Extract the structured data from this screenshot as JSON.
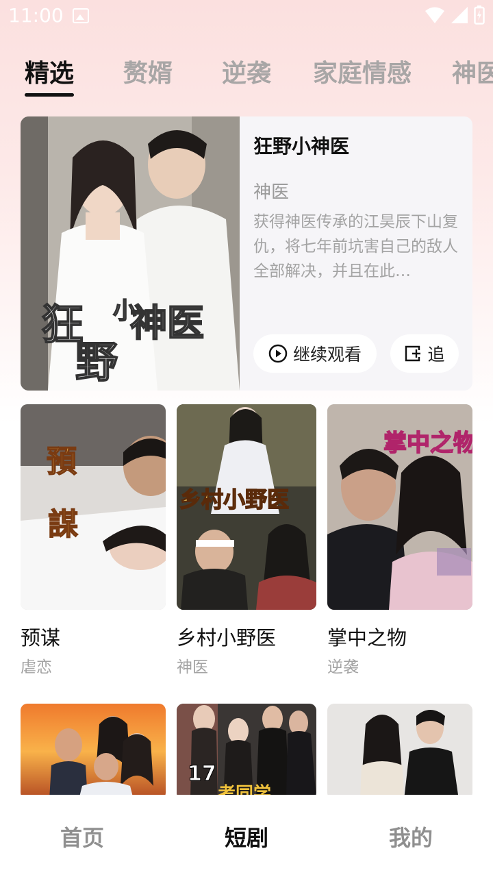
{
  "status_bar": {
    "time": "11:00"
  },
  "tabs": [
    {
      "label": "精选"
    },
    {
      "label": "赘婿"
    },
    {
      "label": "逆袭"
    },
    {
      "label": "家庭情感"
    },
    {
      "label": "神医"
    }
  ],
  "featured": {
    "title": "狂野小神医",
    "cover_text": "狂野小神医",
    "genre": "神医",
    "description": "获得神医传承的江昊辰下山复仇，将七年前坑害自己的敌人全部解决，并且在此…",
    "watch_label": "继续观看",
    "follow_label": "追"
  },
  "dramas": [
    {
      "title": "预谋",
      "genre": "虐恋",
      "cover_text": "预謀"
    },
    {
      "title": "乡村小野医",
      "genre": "神医",
      "cover_text": "乡村小野医"
    },
    {
      "title": "掌中之物",
      "genre": "逆袭",
      "cover_text": "掌中之物"
    },
    {
      "title": "",
      "genre": "",
      "cover_text": ""
    },
    {
      "title": "",
      "genre": "",
      "cover_text": "17"
    },
    {
      "title": "",
      "genre": "",
      "cover_text": ""
    }
  ],
  "bottom_nav": [
    {
      "label": "首页"
    },
    {
      "label": "短剧"
    },
    {
      "label": "我的"
    }
  ],
  "colors": {
    "accent": "#111111",
    "muted": "#a3a3a3",
    "bg_top": "#fbe0df"
  }
}
